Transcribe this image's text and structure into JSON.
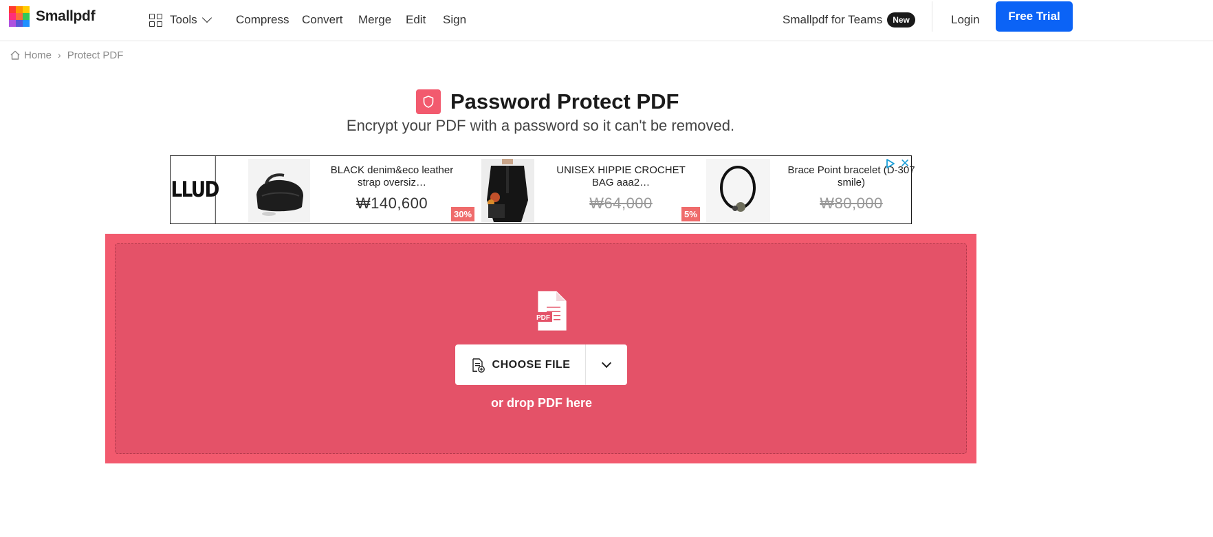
{
  "brand": {
    "name": "Smallpdf"
  },
  "header": {
    "tools_label": "Tools",
    "nav": [
      "Compress",
      "Convert",
      "Merge",
      "Edit",
      "Sign"
    ],
    "teams_label": "Smallpdf for Teams",
    "teams_badge": "New",
    "login_label": "Login",
    "trial_label": "Free Trial",
    "trial_color": "#0b63f6"
  },
  "breadcrumb": {
    "home": "Home",
    "separator": "›",
    "current": "Protect PDF"
  },
  "hero": {
    "title": "Password Protect PDF",
    "subtitle": "Encrypt your PDF with a password so it can't be removed.",
    "accent_color": "#f25a6e"
  },
  "ad": {
    "brand": "LLUD",
    "items": [
      {
        "name": "BLACK denim&eco leather strap oversiz…",
        "price": "₩140,600",
        "discount": "",
        "strikethrough": false,
        "image_icon": "bag-photo"
      },
      {
        "name": "UNISEX HIPPIE CROCHET BAG aaa2…",
        "price": "₩64,000",
        "discount": "30%",
        "strikethrough": true,
        "image_icon": "person-photo"
      },
      {
        "name": "Brace Point bracelet (D-307 smile)",
        "price": "₩80,000",
        "discount": "5%",
        "strikethrough": true,
        "image_icon": "bracelet-photo"
      }
    ],
    "close_glyph": "✕"
  },
  "dropzone": {
    "file_badge": "PDF",
    "choose_label": "CHOOSE FILE",
    "hint": "or drop PDF here"
  }
}
